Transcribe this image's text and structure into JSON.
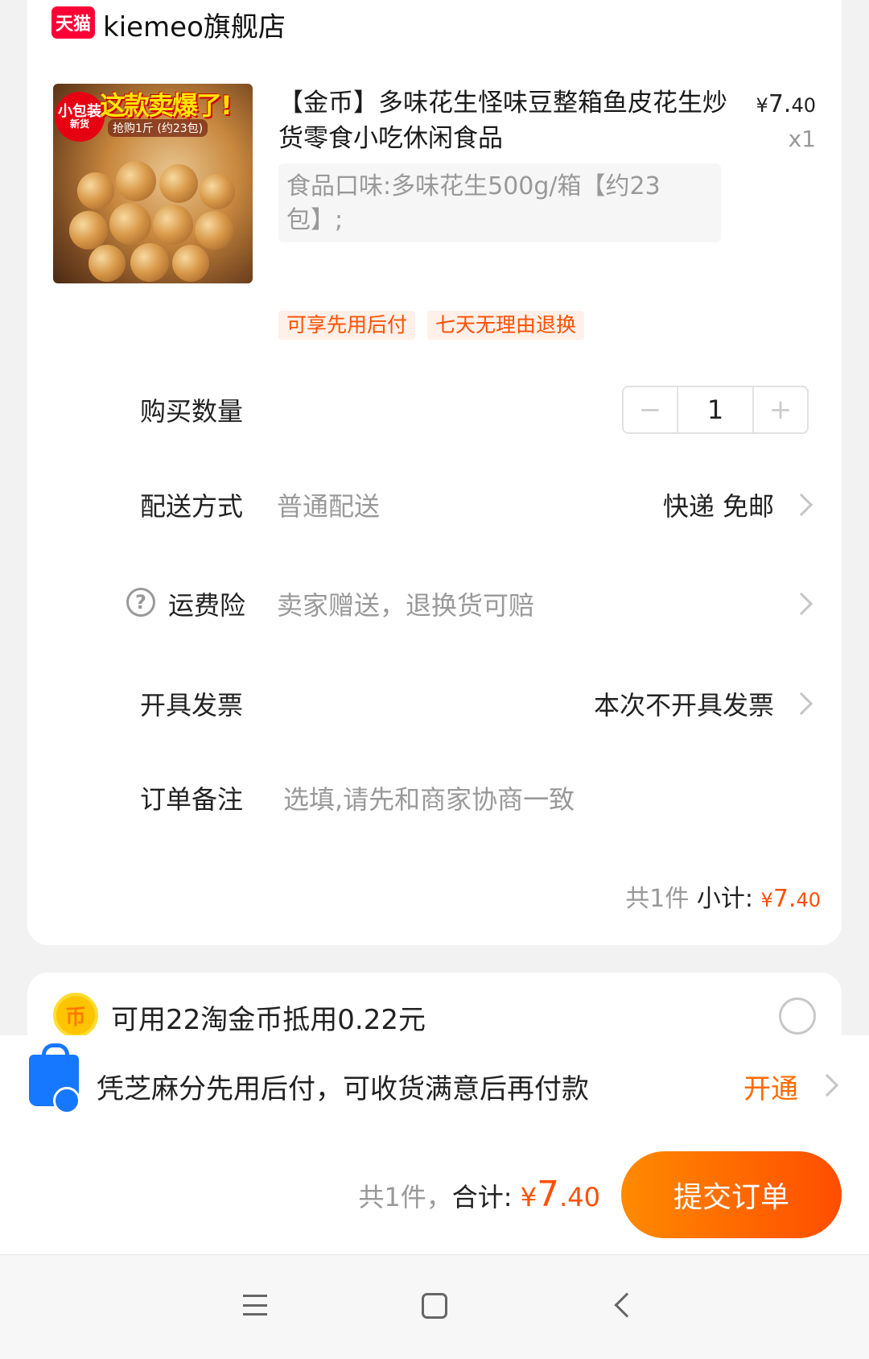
{
  "store": {
    "logo_text": "天猫",
    "name": "kiemeo旗舰店"
  },
  "product": {
    "image_banner": "这款卖爆了!",
    "image_badge_line1": "小包装",
    "image_badge_line2": "新货",
    "image_subtitle": "抢购1斤 (约23包)",
    "title": "【金币】多味花生怪味豆整箱鱼皮花生炒货零食小吃休闲食品",
    "price_currency": "¥",
    "price_int": "7.",
    "price_dec": "40",
    "quantity_text": "x1",
    "sku": "食品口味:多味花生500g/箱【约23包】;",
    "tags": [
      "可享先用后付",
      "七天无理由退换"
    ]
  },
  "rows": {
    "quantity": {
      "label": "购买数量",
      "minus": "−",
      "value": "1",
      "plus": "+"
    },
    "delivery": {
      "label": "配送方式",
      "sub": "普通配送",
      "value": "快递 免邮"
    },
    "insurance": {
      "icon": "?",
      "label": "运费险",
      "sub": "卖家赠送，退换货可赔"
    },
    "invoice": {
      "label": "开具发票",
      "value": "本次不开具发票"
    },
    "remark": {
      "label": "订单备注",
      "placeholder": "选填,请先和商家协商一致"
    }
  },
  "subtotal": {
    "count": "共1件",
    "label": "小计:",
    "currency": "¥",
    "int": "7.",
    "dec": "40"
  },
  "coin": {
    "icon": "币",
    "text": "可用22淘金币抵用0.22元"
  },
  "pay_later": {
    "text": "凭芝麻分先用后付，可收货满意后再付款",
    "action": "开通"
  },
  "total": {
    "count": "共1件，",
    "label": "合计:",
    "currency": "¥",
    "int": "7",
    "dec": ".40"
  },
  "submit_label": "提交订单",
  "colors": {
    "accent": "#ff5000",
    "submit_start": "#ff8a00",
    "submit_end": "#ff4d00",
    "tmall": "#ff0036"
  }
}
